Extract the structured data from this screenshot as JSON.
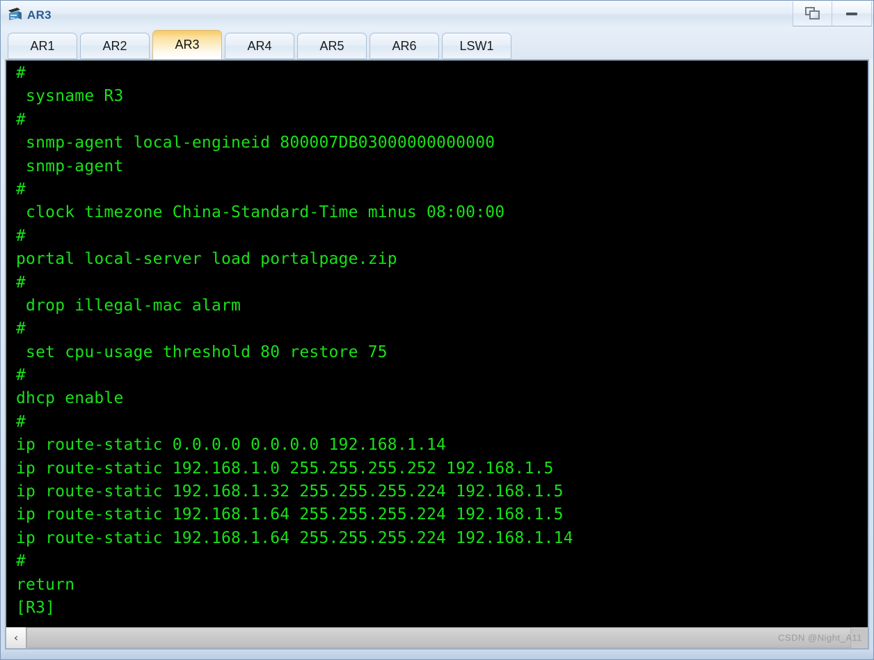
{
  "window": {
    "title": "AR3",
    "icon": "router-icon",
    "controls": [
      {
        "name": "restore-button",
        "icon": "restore-icon",
        "label": ""
      },
      {
        "name": "minimize-button",
        "icon": "minimize-icon",
        "label": ""
      }
    ]
  },
  "tabs": [
    {
      "label": "AR1",
      "active": false
    },
    {
      "label": "AR2",
      "active": false
    },
    {
      "label": "AR3",
      "active": true
    },
    {
      "label": "AR4",
      "active": false
    },
    {
      "label": "AR5",
      "active": false
    },
    {
      "label": "AR6",
      "active": false
    },
    {
      "label": "LSW1",
      "active": false
    }
  ],
  "terminal": {
    "foreground": "#19e019",
    "background": "#000000",
    "lines": [
      "#",
      " sysname R3",
      "#",
      " snmp-agent local-engineid 800007DB03000000000000",
      " snmp-agent",
      "#",
      " clock timezone China-Standard-Time minus 08:00:00",
      "#",
      "portal local-server load portalpage.zip",
      "#",
      " drop illegal-mac alarm",
      "#",
      " set cpu-usage threshold 80 restore 75",
      "#",
      "dhcp enable",
      "#",
      "ip route-static 0.0.0.0 0.0.0.0 192.168.1.14",
      "ip route-static 192.168.1.0 255.255.255.252 192.168.1.5",
      "ip route-static 192.168.1.32 255.255.255.224 192.168.1.5",
      "ip route-static 192.168.1.64 255.255.255.224 192.168.1.5",
      "ip route-static 192.168.1.64 255.255.255.224 192.168.1.14",
      "#",
      "return",
      "[R3]"
    ]
  },
  "scrollbar": {
    "left_arrow": "‹"
  },
  "watermark": {
    "text": "CSDN @Night_A11"
  }
}
